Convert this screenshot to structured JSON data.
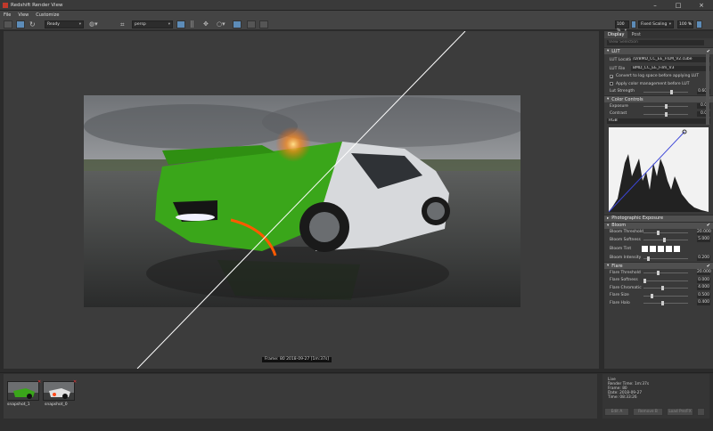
{
  "window": {
    "title": "Redshift Render View"
  },
  "menu": [
    "File",
    "View",
    "Customize"
  ],
  "toolbar": {
    "status_select": "Ready",
    "camera_select": "persp",
    "zoom_left": "100 %",
    "scaling_select": "Fixed Scaling",
    "zoom_right": "100 %"
  },
  "viewport": {
    "frame_info": "Frame: 80   2018-09-27  [1m:37s]"
  },
  "panel": {
    "tabs": [
      "Display",
      "Post"
    ],
    "view_selector": "View Selection",
    "lut": {
      "header": "LUT",
      "location_label": "LUT Location",
      "location_value": "/D/BMD_CC_EE_FILM_V2.cube",
      "file_label": "LUT File",
      "file_value": "BMD_CC_EE_Film_V3",
      "check1": "Convert to log space before applying LUT",
      "check2": "Apply color management before LUT",
      "strength_label": "Lut Strength",
      "strength_value": "0.600"
    },
    "color": {
      "header": "Color Controls",
      "exposure_label": "Exposure",
      "exposure_value": "0.00",
      "contrast_label": "Contrast",
      "contrast_value": "0.00",
      "channel": "RGB"
    },
    "photographic": {
      "header": "Photographic Exposure"
    },
    "bloom": {
      "header": "Bloom",
      "threshold_label": "Bloom Threshold",
      "threshold_value": "20.000",
      "softness_label": "Bloom Softness",
      "softness_value": "5.000",
      "tint_label": "Bloom Tint",
      "intensity_label": "Bloom Intensity",
      "intensity_value": "0.200"
    },
    "flare": {
      "header": "Flare",
      "threshold_label": "Flare Threshold",
      "threshold_value": "20.000",
      "softness_label": "Flare Softness",
      "softness_value": "0.000",
      "chromatic_label": "Flare Chromatic",
      "chromatic_value": "4.000",
      "size_label": "Flare Size",
      "size_value": "0.500",
      "halo_label": "Flare Halo",
      "halo_value": "0.400"
    }
  },
  "snapshots": [
    {
      "label": "snapshot_1"
    },
    {
      "label": "snapshot_0"
    }
  ],
  "info": {
    "title": "Live",
    "render_time": "Render Time: 1m:37s",
    "frame": "Frame: 80",
    "date": "Date: 2018-09-27",
    "time": "Time: 08:33:26"
  },
  "buttons": {
    "edit": "Edit A",
    "remove": "Remove B",
    "load": "Load Pre/FX"
  },
  "colors": {
    "accent": "#5d8cb8",
    "car_green": "#3aa61a",
    "brake_light": "#ff7a1a"
  }
}
